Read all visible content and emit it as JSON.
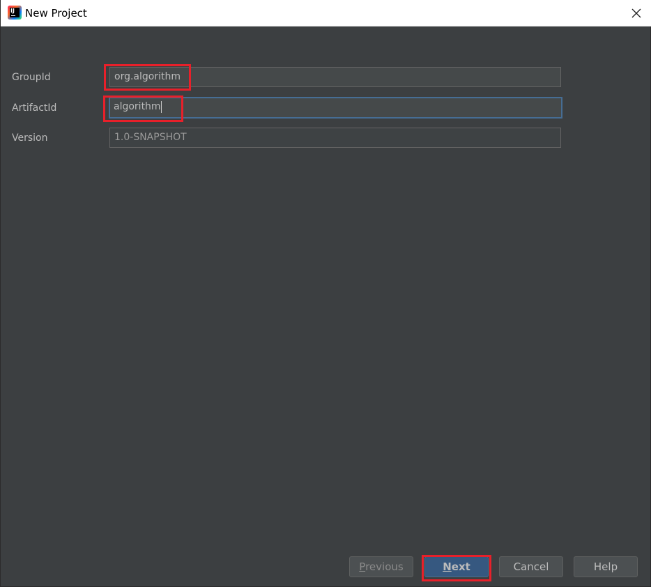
{
  "window": {
    "title": "New Project",
    "icon": "intellij-idea-icon"
  },
  "form": {
    "group_id": {
      "label": "GroupId",
      "value": "org.algorithm"
    },
    "artifact_id": {
      "label": "ArtifactId",
      "value": "algorithm"
    },
    "version": {
      "label": "Version",
      "value": "1.0-SNAPSHOT"
    }
  },
  "buttons": {
    "previous": {
      "mnemonic": "P",
      "rest": "revious"
    },
    "next": {
      "mnemonic": "N",
      "rest": "ext"
    },
    "cancel": "Cancel",
    "help": "Help"
  },
  "colors": {
    "background": "#3c3f41",
    "field_background": "#45494a",
    "focus_border": "#466d94",
    "default_button": "#365880",
    "highlight_annotation": "#e8202a"
  }
}
